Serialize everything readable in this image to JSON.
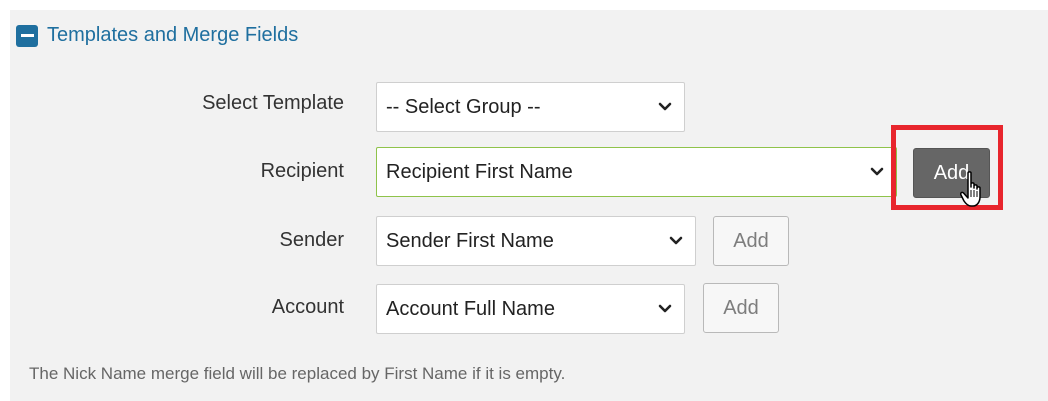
{
  "section": {
    "title": "Templates and Merge Fields",
    "collapse_icon": "minus-square-icon",
    "accent_color": "#1f6f9f"
  },
  "rows": {
    "template": {
      "label": "Select Template",
      "selected": "-- Select Group --"
    },
    "recipient": {
      "label": "Recipient",
      "selected": "Recipient First Name",
      "add_label": "Add"
    },
    "sender": {
      "label": "Sender",
      "selected": "Sender First Name",
      "add_label": "Add"
    },
    "account": {
      "label": "Account",
      "selected": "Account Full Name",
      "add_label": "Add"
    }
  },
  "note": "The Nick Name merge field will be replaced by First Name if it is empty.",
  "highlight_color": "#e8262d"
}
